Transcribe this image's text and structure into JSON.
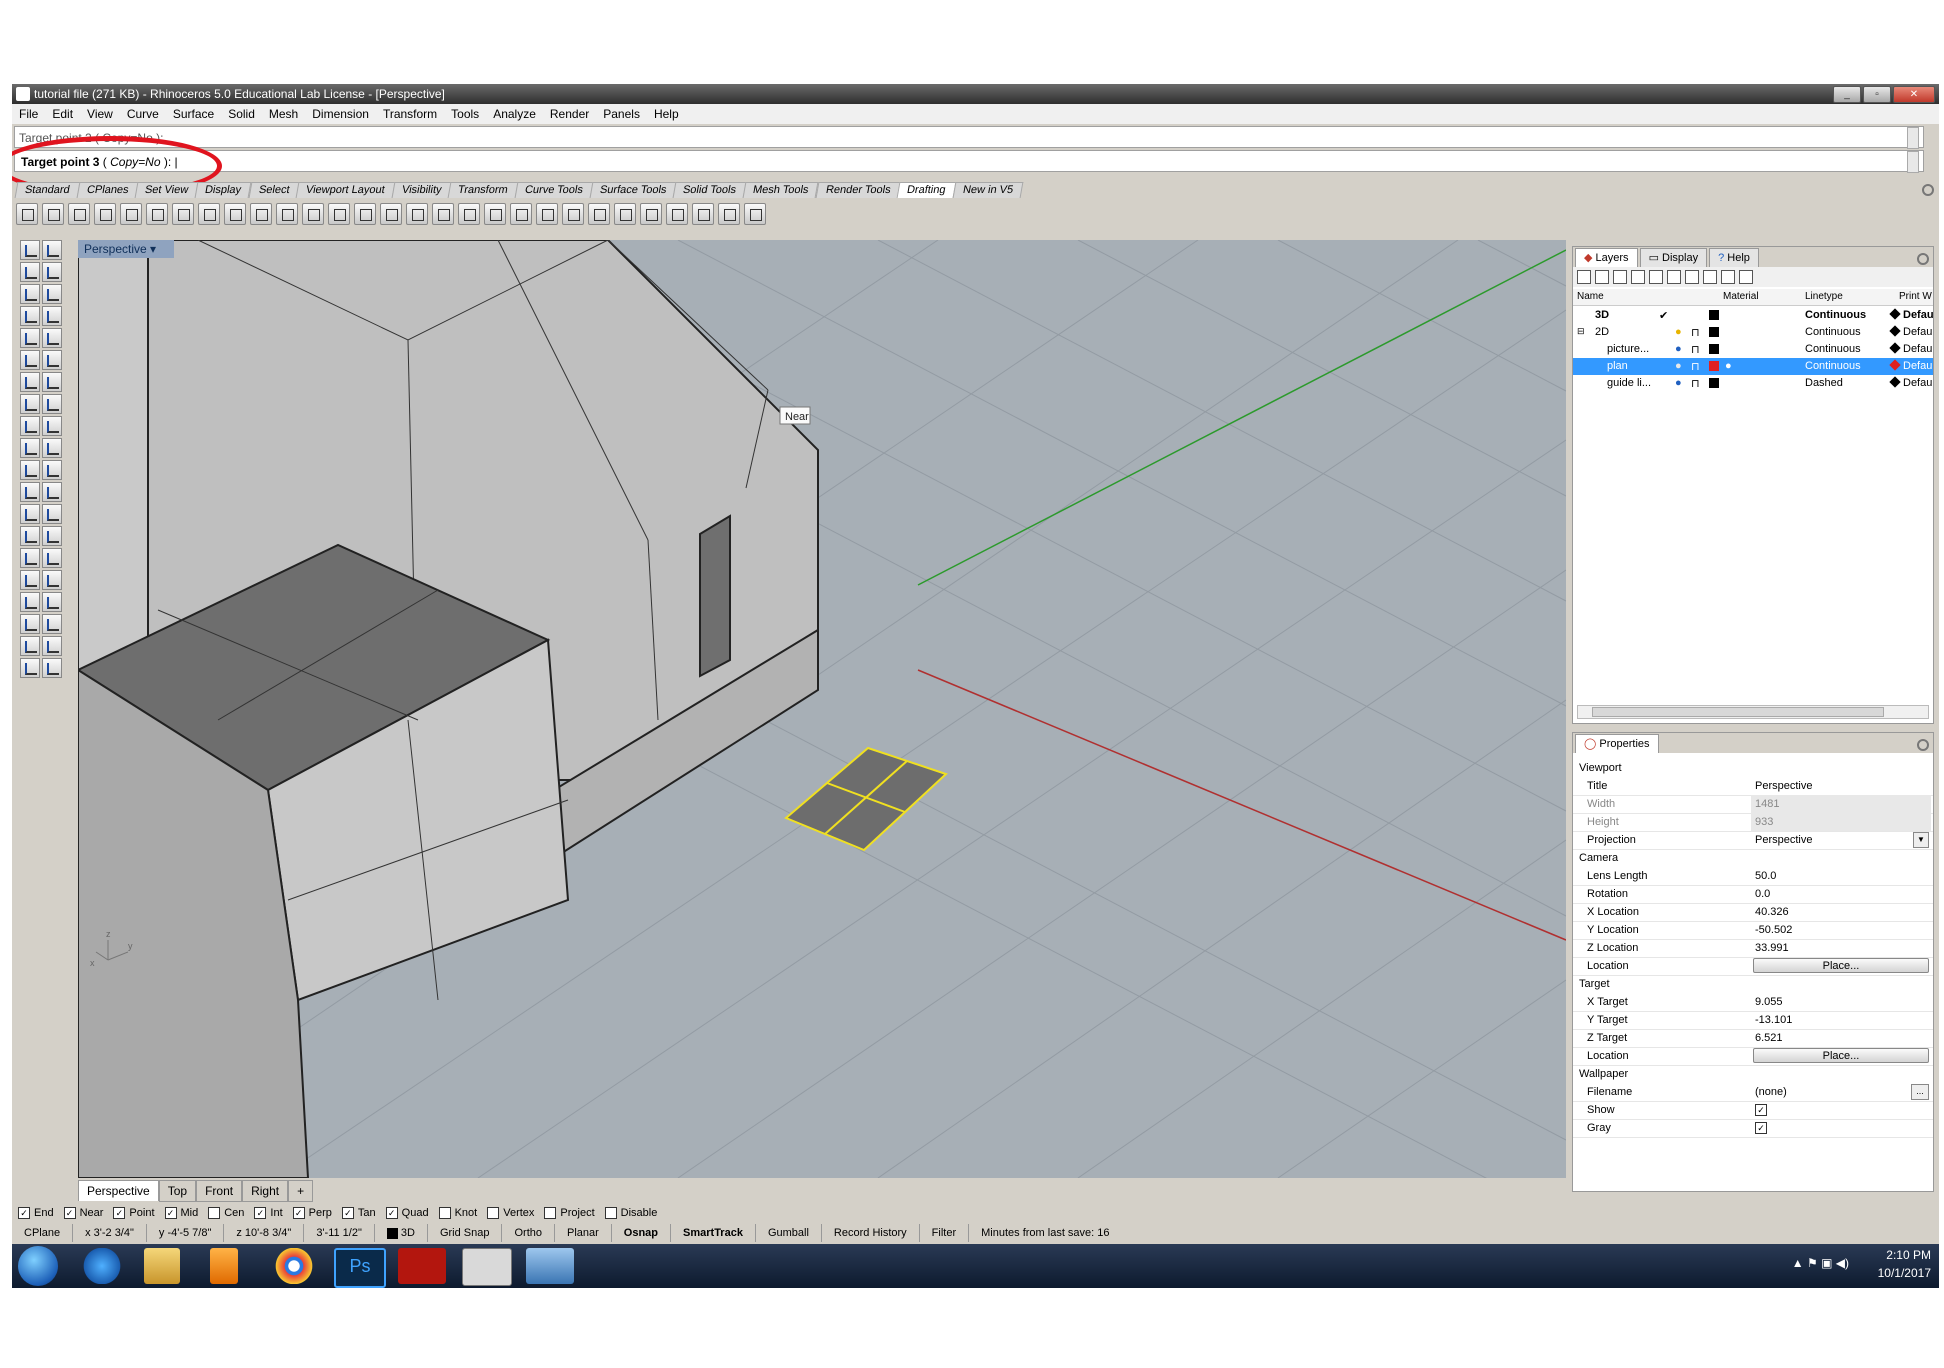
{
  "window": {
    "title": "tutorial file (271 KB) - Rhinoceros 5.0 Educational Lab License - [Perspective]"
  },
  "menu": [
    "File",
    "Edit",
    "View",
    "Curve",
    "Surface",
    "Solid",
    "Mesh",
    "Dimension",
    "Transform",
    "Tools",
    "Analyze",
    "Render",
    "Panels",
    "Help"
  ],
  "command": {
    "history": "Target point 2 ( Copy=No ):",
    "prompt_label": "Target point 3",
    "prompt_open": " ( ",
    "prompt_option": "Copy=No",
    "prompt_close": " ):"
  },
  "toolbar_tabs": [
    "Standard",
    "CPlanes",
    "Set View",
    "Display",
    "Select",
    "Viewport Layout",
    "Visibility",
    "Transform",
    "Curve Tools",
    "Surface Tools",
    "Solid Tools",
    "Mesh Tools",
    "Render Tools",
    "Drafting",
    "New in V5"
  ],
  "active_toolbar_tab": "Drafting",
  "viewport": {
    "label": "Perspective",
    "snap_tooltip": "Near",
    "axis_x": "x",
    "axis_y": "y",
    "axis_z": "z"
  },
  "viewport_tabs": [
    "Perspective",
    "Top",
    "Front",
    "Right",
    "+"
  ],
  "osnaps": [
    {
      "label": "End",
      "checked": true
    },
    {
      "label": "Near",
      "checked": true
    },
    {
      "label": "Point",
      "checked": true
    },
    {
      "label": "Mid",
      "checked": true
    },
    {
      "label": "Cen",
      "checked": false
    },
    {
      "label": "Int",
      "checked": true
    },
    {
      "label": "Perp",
      "checked": true
    },
    {
      "label": "Tan",
      "checked": true
    },
    {
      "label": "Quad",
      "checked": true
    },
    {
      "label": "Knot",
      "checked": false
    },
    {
      "label": "Vertex",
      "checked": false
    },
    {
      "label": "Project",
      "checked": false
    },
    {
      "label": "Disable",
      "checked": false
    }
  ],
  "status": {
    "cplane": "CPlane",
    "x": "x 3'-2 3/4\"",
    "y": "y -4'-5 7/8\"",
    "z": "z 10'-8 3/4\"",
    "dist": "3'-11 1/2\"",
    "layer": "3D",
    "toggles": [
      "Grid Snap",
      "Ortho",
      "Planar",
      "Osnap",
      "SmartTrack",
      "Gumball",
      "Record History",
      "Filter"
    ],
    "bold_toggles": [
      "Osnap",
      "SmartTrack"
    ],
    "message": "Minutes from last save: 16"
  },
  "taskbar": {
    "time": "2:10 PM",
    "date": "10/1/2017"
  },
  "layers_panel": {
    "tabs": [
      "Layers",
      "Display",
      "Help"
    ],
    "columns": [
      "Name",
      "Material",
      "Linetype",
      "Print W"
    ],
    "rows": [
      {
        "name": "3D",
        "current": "✔",
        "linetype": "Continuous",
        "print": "Defaul",
        "bold": true,
        "selected": false
      },
      {
        "name": "2D",
        "current": "",
        "linetype": "Continuous",
        "print": "Default",
        "bold": false,
        "selected": false
      },
      {
        "name": "picture...",
        "current": "",
        "linetype": "Continuous",
        "print": "Default",
        "bold": false,
        "selected": false
      },
      {
        "name": "plan",
        "current": "",
        "linetype": "Continuous",
        "print": "Default",
        "bold": false,
        "selected": true
      },
      {
        "name": "guide li...",
        "current": "",
        "linetype": "Dashed",
        "print": "Default",
        "bold": false,
        "selected": false
      }
    ],
    "colors": {
      "selected": "#3399ff",
      "plan_swatch": "#e02020",
      "light_on": "#e8b400",
      "light_blue": "#2060c0"
    }
  },
  "properties": {
    "tab": "Properties",
    "viewport_group": "Viewport",
    "title_k": "Title",
    "title_v": "Perspective",
    "width_k": "Width",
    "width_v": "1481",
    "height_k": "Height",
    "height_v": "933",
    "projection_k": "Projection",
    "projection_v": "Perspective",
    "camera_group": "Camera",
    "lens_k": "Lens Length",
    "lens_v": "50.0",
    "rot_k": "Rotation",
    "rot_v": "0.0",
    "xloc_k": "X Location",
    "xloc_v": "40.326",
    "yloc_k": "Y Location",
    "yloc_v": "-50.502",
    "zloc_k": "Z Location",
    "zloc_v": "33.991",
    "loc_k": "Location",
    "place": "Place...",
    "target_group": "Target",
    "xt_k": "X Target",
    "xt_v": "9.055",
    "yt_k": "Y Target",
    "yt_v": "-13.101",
    "zt_k": "Z Target",
    "zt_v": "6.521",
    "tloc_k": "Location",
    "wall_group": "Wallpaper",
    "file_k": "Filename",
    "file_v": "(none)",
    "file_btn": "...",
    "show_k": "Show",
    "gray_k": "Gray",
    "show_checked": true,
    "gray_checked": true
  },
  "accent": {
    "highlight_circle": "#e0141e",
    "selection_yellow": "#f0e020",
    "axis_red": "#b03030",
    "axis_green": "#2c9a2c"
  }
}
